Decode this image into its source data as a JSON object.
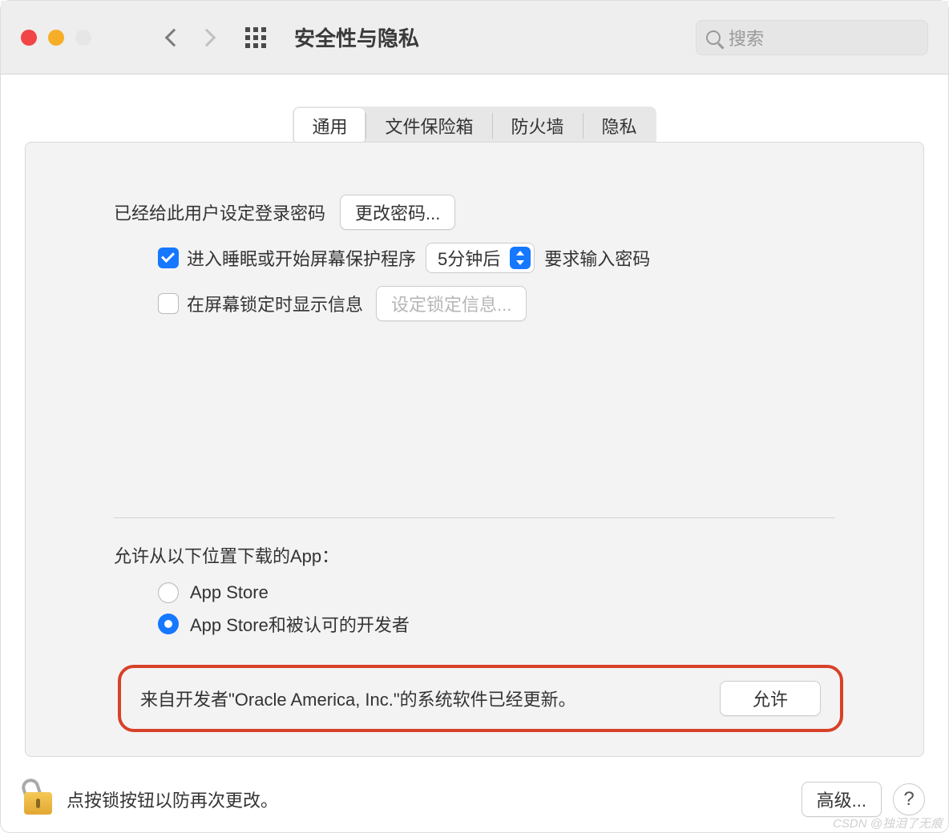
{
  "window": {
    "title": "安全性与隐私",
    "search_placeholder": "搜索"
  },
  "tabs": {
    "general": "通用",
    "filevault": "文件保险箱",
    "firewall": "防火墙",
    "privacy": "隐私"
  },
  "general": {
    "login_password_set": "已经给此用户设定登录密码",
    "change_password": "更改密码...",
    "require_password_prefix": "进入睡眠或开始屏幕保护程序",
    "time_option": "5分钟后",
    "require_password_suffix": "要求输入密码",
    "show_msg_when_locked": "在屏幕锁定时显示信息",
    "set_lock_message": "设定锁定信息..."
  },
  "allow": {
    "heading": "允许从以下位置下载的App：",
    "appstore": "App Store",
    "appstore_and_dev": "App Store和被认可的开发者"
  },
  "blocked": {
    "message": "来自开发者\"Oracle America, Inc.\"的系统软件已经更新。",
    "allow_button": "允许"
  },
  "footer": {
    "lock_text": "点按锁按钮以防再次更改。",
    "advanced": "高级...",
    "help": "?"
  },
  "watermark": "CSDN @独泪了无痕"
}
